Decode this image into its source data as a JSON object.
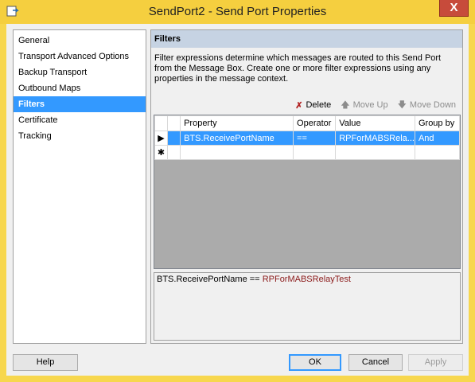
{
  "window": {
    "title": "SendPort2 - Send Port Properties",
    "close_glyph": "X"
  },
  "nav": {
    "items": [
      {
        "label": "General"
      },
      {
        "label": "Transport Advanced Options"
      },
      {
        "label": "Backup Transport"
      },
      {
        "label": "Outbound Maps"
      },
      {
        "label": "Filters"
      },
      {
        "label": "Certificate"
      },
      {
        "label": "Tracking"
      }
    ],
    "selected": "Filters"
  },
  "panel": {
    "header": "Filters",
    "description": "Filter expressions determine which messages are routed to this Send Port from the Message Box. Create one or more filter expressions using any properties in the message context."
  },
  "toolbar": {
    "delete_label": "Delete",
    "move_up_label": "Move Up",
    "move_down_label": "Move Down"
  },
  "grid": {
    "columns": [
      "Property",
      "Operator",
      "Value",
      "Group by"
    ],
    "rows": [
      {
        "marker": "▶",
        "property": "BTS.ReceivePortName",
        "operator": "==",
        "value": "RPForMABSRela...",
        "group_by": "And"
      }
    ],
    "new_row_marker": "✱"
  },
  "expression": {
    "left": "BTS.ReceivePortName ==",
    "value": "RPForMABSRelayTest"
  },
  "buttons": {
    "help": "Help",
    "ok": "OK",
    "cancel": "Cancel",
    "apply": "Apply"
  },
  "colors": {
    "title_bar": "#f5cf3f",
    "selection": "#3399ff",
    "panel_header": "#c6d3e3",
    "expression_value": "#8b1a1a"
  }
}
